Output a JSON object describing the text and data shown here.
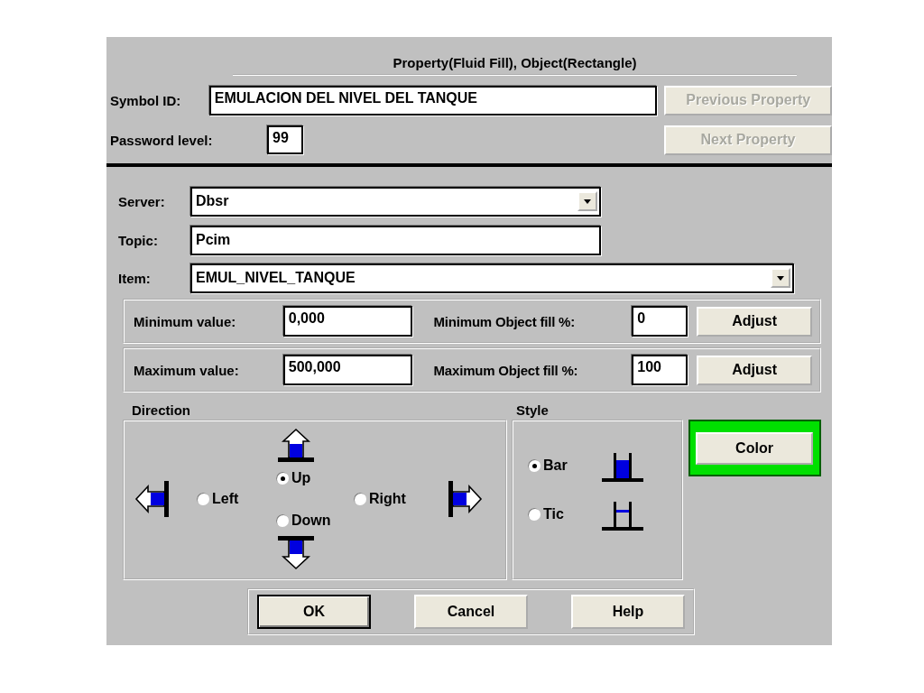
{
  "dialog": {
    "title": "Property(Fluid Fill), Object(Rectangle)",
    "symbol_id": {
      "label": "Symbol ID:",
      "value": "EMULACION DEL NIVEL DEL TANQUE"
    },
    "previous_button": {
      "label": "Previous Property",
      "disabled": true
    },
    "password_level": {
      "label": "Password level:",
      "value": "99"
    },
    "next_button": {
      "label": "Next Property",
      "disabled": true
    },
    "server": {
      "label": "Server:",
      "value": "Dbsr"
    },
    "topic": {
      "label": "Topic:",
      "value": "Pcim"
    },
    "item": {
      "label": "Item:",
      "value": "EMUL_NIVEL_TANQUE"
    },
    "ranges": [
      {
        "label": "Minimum value:",
        "value": "0,000",
        "fill_label": "Minimum Object fill %:",
        "fill_value": "0",
        "button": "Adjust"
      },
      {
        "label": "Maximum value:",
        "value": "500,000",
        "fill_label": "Maximum Object fill %:",
        "fill_value": "100",
        "button": "Adjust"
      }
    ],
    "direction": {
      "label": "Direction",
      "options": [
        {
          "kind": "up",
          "label": "Up",
          "selected": true
        },
        {
          "kind": "left",
          "label": "Left",
          "selected": false
        },
        {
          "kind": "right",
          "label": "Right",
          "selected": false
        },
        {
          "kind": "down",
          "label": "Down",
          "selected": false
        }
      ]
    },
    "style": {
      "label": "Style",
      "options": [
        {
          "kind": "bar",
          "label": "Bar",
          "selected": true
        },
        {
          "kind": "tic",
          "label": "Tic",
          "selected": false
        }
      ]
    },
    "color_button": {
      "label": "Color",
      "highlighted": true
    },
    "buttons": [
      {
        "label": "OK",
        "default": true
      },
      {
        "label": "Cancel",
        "default": false
      },
      {
        "label": "Help",
        "default": false
      }
    ]
  }
}
